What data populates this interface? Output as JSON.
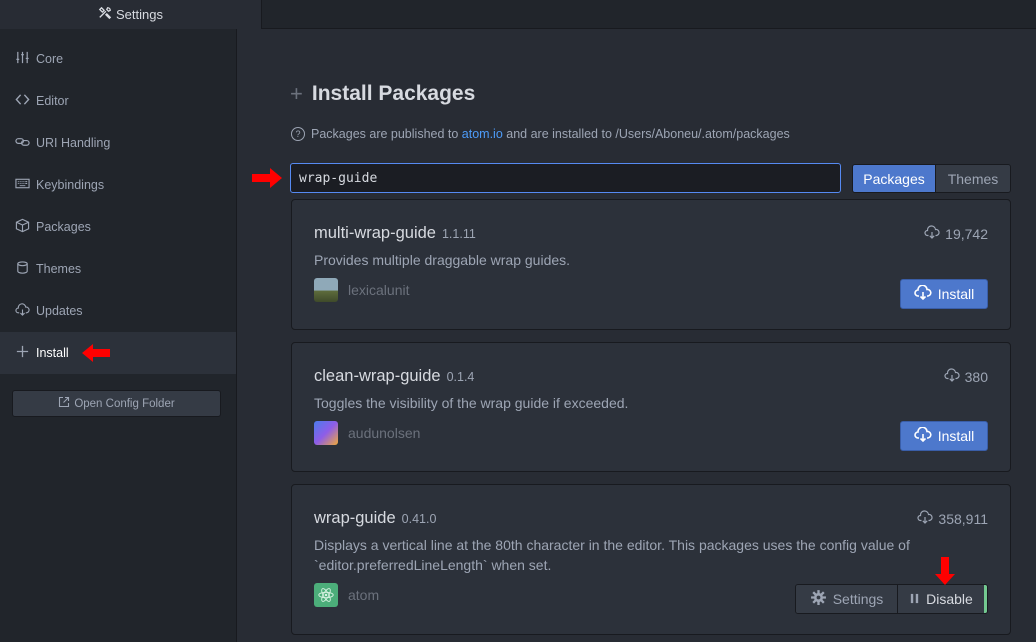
{
  "tab": {
    "title": "Settings",
    "icon": "tools-icon"
  },
  "sidebar": {
    "items": [
      {
        "label": "Core",
        "icon": "sliders-icon"
      },
      {
        "label": "Editor",
        "icon": "code-icon"
      },
      {
        "label": "URI Handling",
        "icon": "link-icon"
      },
      {
        "label": "Keybindings",
        "icon": "keyboard-icon"
      },
      {
        "label": "Packages",
        "icon": "package-icon"
      },
      {
        "label": "Themes",
        "icon": "paintcan-icon"
      },
      {
        "label": "Updates",
        "icon": "cloud-download-icon"
      },
      {
        "label": "Install",
        "icon": "plus-icon",
        "active": true
      }
    ],
    "open_config_label": "Open Config Folder"
  },
  "main": {
    "title": "Install Packages",
    "info": {
      "prefix": "Packages are published to ",
      "link": "atom.io",
      "suffix": " and are installed to /Users/Aboneu/.atom/packages"
    },
    "search": {
      "value": "wrap-guide"
    },
    "toggle": {
      "packages": "Packages",
      "themes": "Themes",
      "selected": "Packages"
    },
    "packages": [
      {
        "name": "multi-wrap-guide",
        "version": "1.1.11",
        "description": "Provides multiple draggable wrap guides.",
        "owner": "lexicalunit",
        "downloads": "19,742",
        "action": "Install"
      },
      {
        "name": "clean-wrap-guide",
        "version": "0.1.4",
        "description": "Toggles the visibility of the wrap guide if exceeded.",
        "owner": "audunolsen",
        "downloads": "380",
        "action": "Install"
      },
      {
        "name": "wrap-guide",
        "version": "0.41.0",
        "description": "Displays a vertical line at the 80th character in the editor. This packages uses the config value of `editor.preferredLineLength` when set.",
        "owner": "atom",
        "downloads": "358,911",
        "settings_label": "Settings",
        "disable_label": "Disable"
      }
    ]
  },
  "colors": {
    "accent": "#4d78cc",
    "link": "#4d9bf8",
    "enabled": "#73c990",
    "annotation": "#ff0000"
  }
}
